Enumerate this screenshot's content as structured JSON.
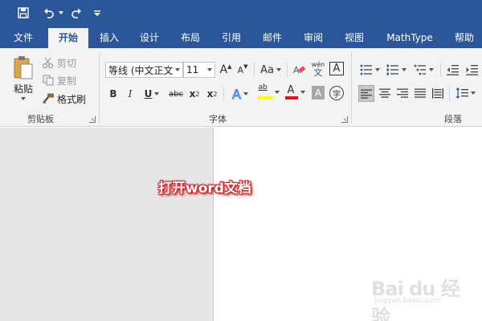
{
  "quick_access": {
    "icons": [
      "save-icon",
      "undo-icon",
      "redo-icon",
      "customize-icon"
    ]
  },
  "tabs": [
    {
      "label": "文件",
      "active": false
    },
    {
      "label": "开始",
      "active": true
    },
    {
      "label": "插入",
      "active": false
    },
    {
      "label": "设计",
      "active": false
    },
    {
      "label": "布局",
      "active": false
    },
    {
      "label": "引用",
      "active": false
    },
    {
      "label": "邮件",
      "active": false
    },
    {
      "label": "审阅",
      "active": false
    },
    {
      "label": "视图",
      "active": false
    },
    {
      "label": "MathType",
      "active": false
    },
    {
      "label": "帮助",
      "active": false
    }
  ],
  "clipboard": {
    "paste_label": "粘贴",
    "cut_label": "剪切",
    "copy_label": "复制",
    "format_painter_label": "格式刷",
    "group_label": "剪贴板"
  },
  "font": {
    "font_name": "等线 (中文正文",
    "font_size": "11",
    "grow_label": "A",
    "shrink_label": "A",
    "case_label": "Aa",
    "phonetic_top": "wén",
    "phonetic_bottom": "文",
    "border_label": "A",
    "bold": "B",
    "italic": "I",
    "underline": "U",
    "strike": "abc",
    "subscript": "x",
    "subscript_mark": "2",
    "superscript": "x",
    "superscript_mark": "2",
    "effects": "A",
    "highlight": "ab",
    "font_color": "A",
    "shading": "A",
    "enclose": "字",
    "group_label": "字体",
    "font_color_value": "#e81123",
    "highlight_color_value": "#ffff00"
  },
  "paragraph": {
    "group_label": "段落"
  },
  "document": {
    "annotation": "打开word文档"
  },
  "watermark": {
    "main": "Bai du 经验",
    "sub": "jingyan.baidu.com"
  },
  "colors": {
    "title_bar": "#2b579a",
    "ribbon_bg": "#f3f3f3"
  }
}
